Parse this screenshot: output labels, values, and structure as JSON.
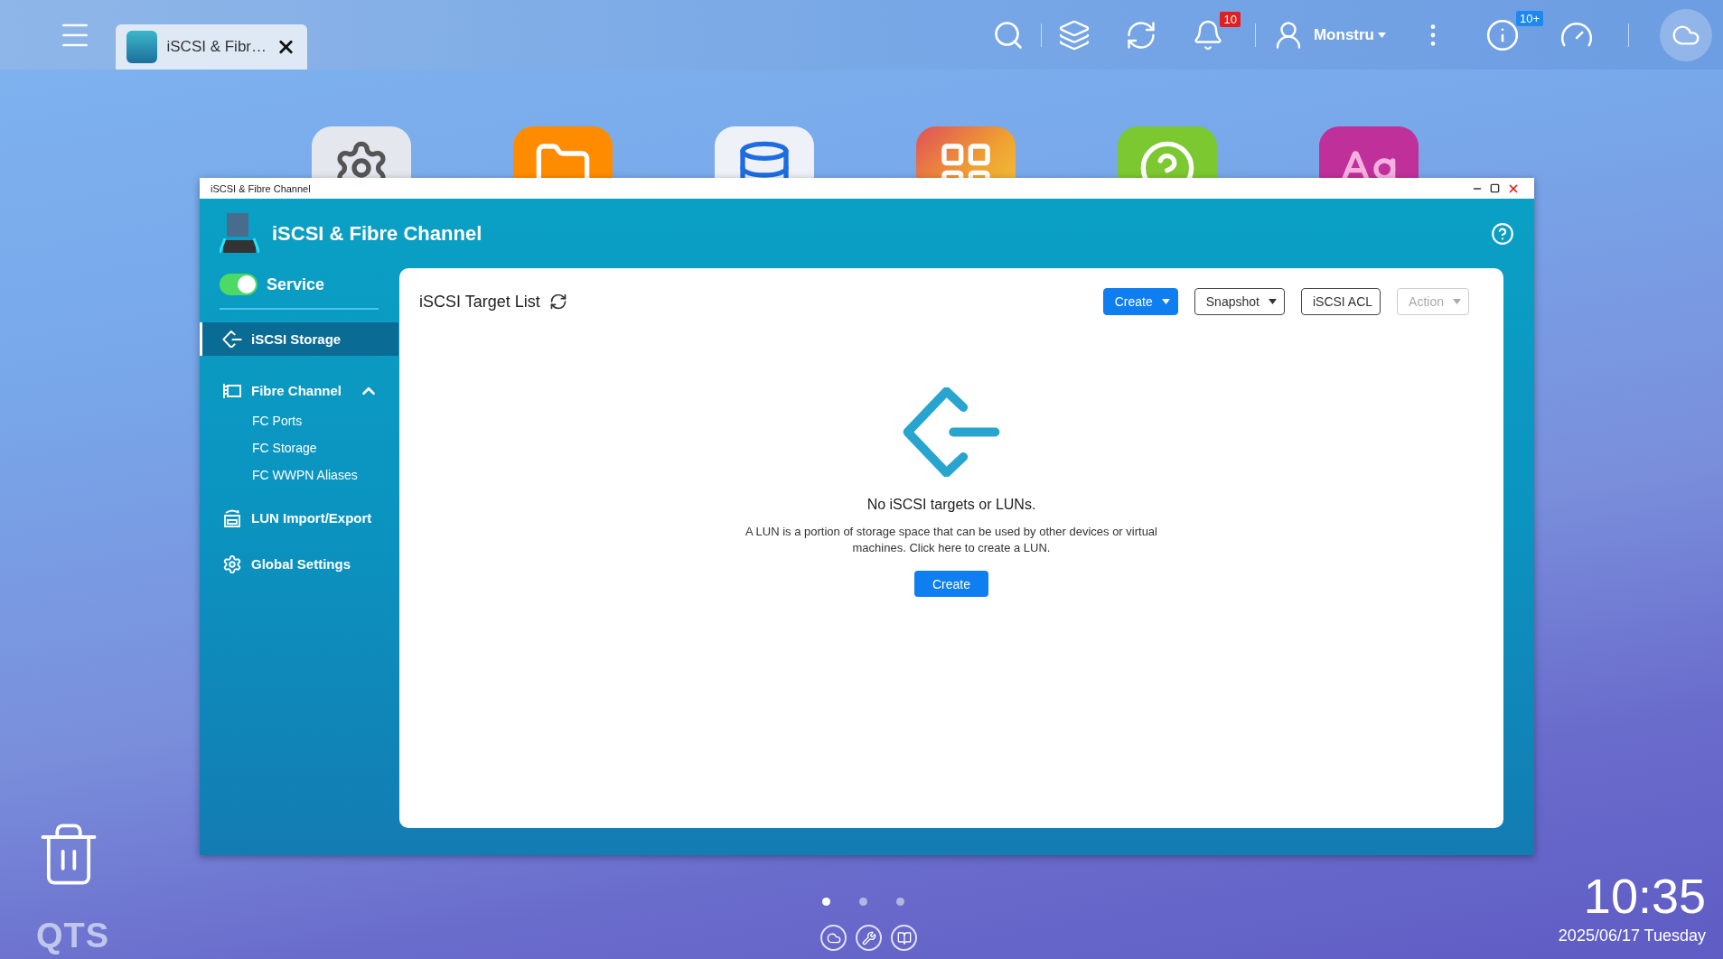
{
  "topbar": {
    "tab": {
      "title": "iSCSI & Fibr…"
    },
    "notifications_badge": "10",
    "user": {
      "name": "Monstru"
    },
    "info_badge": "10+"
  },
  "desktop": {
    "page_dots": [
      {
        "selected": true
      },
      {
        "selected": false
      },
      {
        "selected": false
      }
    ],
    "logo": "QTS",
    "clock": {
      "time": "10:35",
      "date": "2025/06/17 Tuesday"
    }
  },
  "window": {
    "title": "iSCSI & Fibre Channel",
    "app_name": "iSCSI & Fibre Channel",
    "service": {
      "label": "Service",
      "on": true
    },
    "sidebar": {
      "items": [
        {
          "kind": "iscsi",
          "label": "iSCSI Storage",
          "selected": true
        },
        {
          "kind": "fibre",
          "label": "Fibre Channel",
          "selected": false,
          "expanded": true,
          "children": [
            {
              "label": "FC Ports",
              "selected": false
            },
            {
              "label": "FC Storage",
              "selected": false
            },
            {
              "label": "FC WWPN Aliases",
              "selected": false
            }
          ]
        },
        {
          "kind": "lun",
          "label": "LUN Import/Export",
          "selected": false
        },
        {
          "kind": "settings",
          "label": "Global Settings",
          "selected": false
        }
      ]
    },
    "panel": {
      "title": "iSCSI Target List",
      "toolbar": [
        {
          "kind": "primary",
          "label": "Create",
          "dropdown": true,
          "disabled": false
        },
        {
          "kind": "outline",
          "label": "Snapshot",
          "dropdown": true,
          "disabled": false
        },
        {
          "kind": "outline",
          "label": "iSCSI ACL",
          "dropdown": false,
          "disabled": false
        },
        {
          "kind": "outline",
          "label": "Action",
          "dropdown": true,
          "disabled": true
        }
      ],
      "empty_state": {
        "heading": "No iSCSI targets or LUNs.",
        "message": "A LUN is a portion of storage space that can be used by other devices or virtual machines. Click here to create a LUN.",
        "button": "Create"
      }
    }
  }
}
